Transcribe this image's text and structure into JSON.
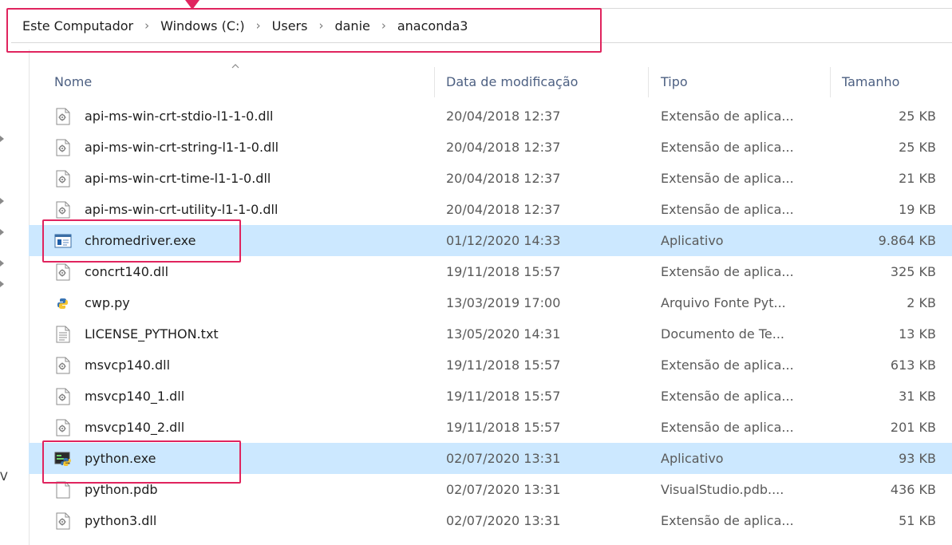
{
  "breadcrumb": [
    "Este Computador",
    "Windows (C:)",
    "Users",
    "danie",
    "anaconda3"
  ],
  "breadcrumb_separator": "›",
  "columns": {
    "name": "Nome",
    "date": "Data de modificação",
    "type": "Tipo",
    "size": "Tamanho"
  },
  "nav_fragment": "V",
  "files": [
    {
      "name": "api-ms-win-crt-stdio-l1-1-0.dll",
      "date": "20/04/2018 12:37",
      "type": "Extensão de aplica...",
      "size": "25 KB",
      "icon": "dll-icon",
      "selected": false
    },
    {
      "name": "api-ms-win-crt-string-l1-1-0.dll",
      "date": "20/04/2018 12:37",
      "type": "Extensão de aplica...",
      "size": "25 KB",
      "icon": "dll-icon",
      "selected": false
    },
    {
      "name": "api-ms-win-crt-time-l1-1-0.dll",
      "date": "20/04/2018 12:37",
      "type": "Extensão de aplica...",
      "size": "21 KB",
      "icon": "dll-icon",
      "selected": false
    },
    {
      "name": "api-ms-win-crt-utility-l1-1-0.dll",
      "date": "20/04/2018 12:37",
      "type": "Extensão de aplica...",
      "size": "19 KB",
      "icon": "dll-icon",
      "selected": false
    },
    {
      "name": "chromedriver.exe",
      "date": "01/12/2020 14:33",
      "type": "Aplicativo",
      "size": "9.864 KB",
      "icon": "application-icon",
      "selected": true
    },
    {
      "name": "concrt140.dll",
      "date": "19/11/2018 15:57",
      "type": "Extensão de aplica...",
      "size": "325 KB",
      "icon": "dll-icon",
      "selected": false
    },
    {
      "name": "cwp.py",
      "date": "13/03/2019 17:00",
      "type": "Arquivo Fonte Pyt...",
      "size": "2 KB",
      "icon": "python-file-icon",
      "selected": false
    },
    {
      "name": "LICENSE_PYTHON.txt",
      "date": "13/05/2020 14:31",
      "type": "Documento de Te...",
      "size": "13 KB",
      "icon": "text-file-icon",
      "selected": false
    },
    {
      "name": "msvcp140.dll",
      "date": "19/11/2018 15:57",
      "type": "Extensão de aplica...",
      "size": "613 KB",
      "icon": "dll-icon",
      "selected": false
    },
    {
      "name": "msvcp140_1.dll",
      "date": "19/11/2018 15:57",
      "type": "Extensão de aplica...",
      "size": "31 KB",
      "icon": "dll-icon",
      "selected": false
    },
    {
      "name": "msvcp140_2.dll",
      "date": "19/11/2018 15:57",
      "type": "Extensão de aplica...",
      "size": "201 KB",
      "icon": "dll-icon",
      "selected": false
    },
    {
      "name": "python.exe",
      "date": "02/07/2020 13:31",
      "type": "Aplicativo",
      "size": "93 KB",
      "icon": "python-exe-icon",
      "selected": true
    },
    {
      "name": "python.pdb",
      "date": "02/07/2020 13:31",
      "type": "VisualStudio.pdb....",
      "size": "436 KB",
      "icon": "blank-file-icon",
      "selected": false
    },
    {
      "name": "python3.dll",
      "date": "02/07/2020 13:31",
      "type": "Extensão de aplica...",
      "size": "51 KB",
      "icon": "dll-icon",
      "selected": false
    }
  ],
  "colors": {
    "highlight": "#e0245e",
    "selection": "#cce8ff",
    "header_text": "#4d6082"
  }
}
